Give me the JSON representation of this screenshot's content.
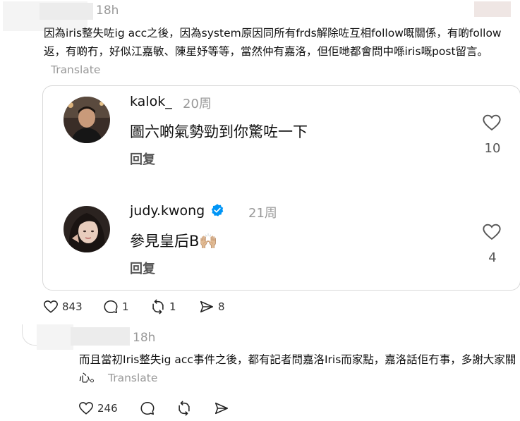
{
  "post1": {
    "time": "18h",
    "text": "因為iris整失咗ig acc之後，因為system原因同所有frds解除咗互相follow嘅關係，有啲follow返，有啲冇，好似江嘉敏、陳星妤等等，當然仲有嘉洛，但佢哋都會問中喺iris嘅post留言。",
    "translate": "Translate",
    "actions": {
      "likes": "843",
      "comments": "1",
      "reposts": "1",
      "shares": "8"
    }
  },
  "quote": {
    "replies": [
      {
        "username": "kalok_",
        "time": "20周",
        "text": "圖六啲氣勢勁到你驚咗一下",
        "reply_label": "回复",
        "likes": "10",
        "verified": false,
        "avatar_icon": "man-portrait"
      },
      {
        "username": "judy.kwong",
        "time": "21周",
        "text": "參見皇后B🙌🏼",
        "reply_label": "回复",
        "likes": "4",
        "verified": true,
        "avatar_icon": "woman-portrait"
      }
    ]
  },
  "post2": {
    "time": "18h",
    "text": "而且當初Iris整失ig acc事件之後，都有記者問嘉洛Iris而家點，嘉洛話佢冇事，多謝大家關心。",
    "translate": "Translate",
    "actions": {
      "likes": "246"
    }
  },
  "colors": {
    "verified_blue": "#0095f6",
    "muted": "#999999",
    "border": "#d9d9d9"
  }
}
